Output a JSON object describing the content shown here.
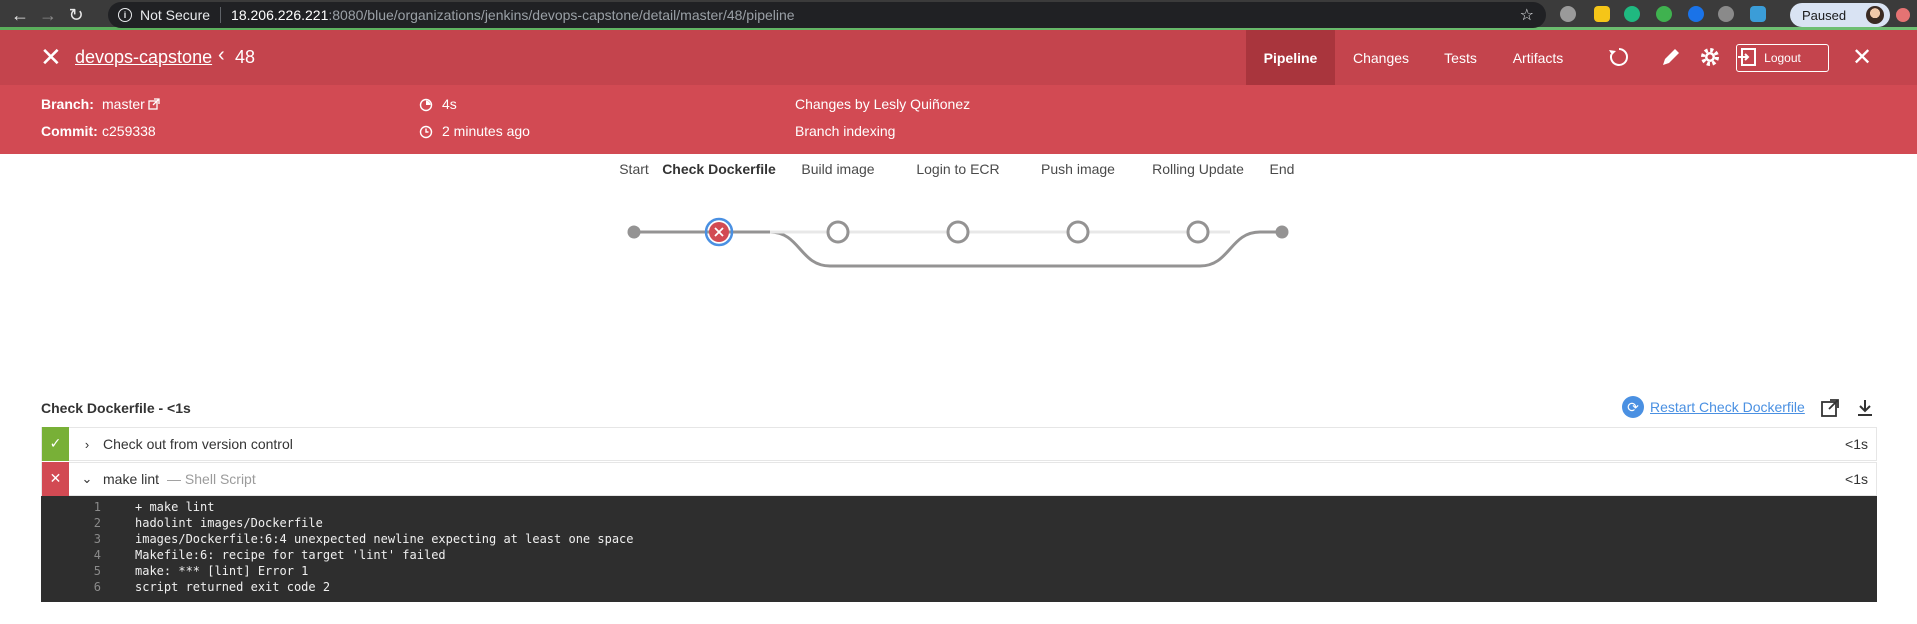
{
  "browser": {
    "security_label": "Not Secure",
    "url_host": "18.206.226.221",
    "url_rest": ":8080/blue/organizations/jenkins/devops-capstone/detail/master/48/pipeline",
    "profile_label": "Paused"
  },
  "header": {
    "project": "devops-capstone",
    "run_number": "48",
    "tabs": [
      {
        "label": "Pipeline",
        "active": true
      },
      {
        "label": "Changes",
        "active": false
      },
      {
        "label": "Tests",
        "active": false
      },
      {
        "label": "Artifacts",
        "active": false
      }
    ],
    "logout_label": "Logout"
  },
  "run_info": {
    "branch_label": "Branch:",
    "branch_value": "master",
    "commit_label": "Commit:",
    "commit_value": "c259338",
    "duration": "4s",
    "started": "2 minutes ago",
    "changes": "Changes by Lesly Quiñonez",
    "cause": "Branch indexing"
  },
  "pipeline": {
    "stages": [
      {
        "label": "Start",
        "status": "start"
      },
      {
        "label": "Check Dockerfile",
        "status": "failed",
        "selected": true
      },
      {
        "label": "Build image",
        "status": "not_built"
      },
      {
        "label": "Login to ECR",
        "status": "not_built"
      },
      {
        "label": "Push image",
        "status": "not_built"
      },
      {
        "label": "Rolling Update",
        "status": "not_built"
      },
      {
        "label": "End",
        "status": "end"
      }
    ]
  },
  "log": {
    "title": "Check Dockerfile - <1s",
    "restart_label": "Restart Check Dockerfile",
    "steps": [
      {
        "label": "Check out from version control",
        "sub": "",
        "duration": "<1s",
        "status": "success",
        "caret": "›"
      },
      {
        "label": "make lint",
        "sub": "— Shell Script",
        "duration": "<1s",
        "status": "failed",
        "caret": "⌄"
      }
    ],
    "console_lines": [
      {
        "n": "1",
        "text": "+ make lint"
      },
      {
        "n": "2",
        "text": "hadolint images/Dockerfile"
      },
      {
        "n": "3",
        "text": "images/Dockerfile:6:4 unexpected newline expecting at least one space"
      },
      {
        "n": "4",
        "text": "Makefile:6: recipe for target 'lint' failed"
      },
      {
        "n": "5",
        "text": "make: *** [lint] Error 1"
      },
      {
        "n": "6",
        "text": "script returned exit code 2"
      }
    ]
  },
  "colors": {
    "header_bg": "#c4444d",
    "band_bg": "#d24a53",
    "success": "#78b037",
    "failed": "#d24a53",
    "link": "#4a90e2"
  }
}
